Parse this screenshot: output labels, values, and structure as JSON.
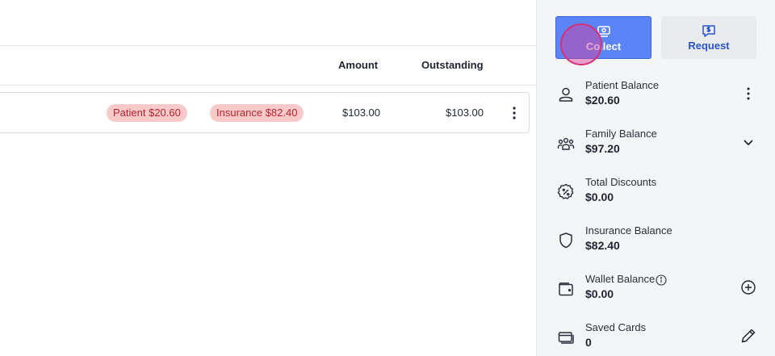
{
  "table": {
    "columns": {
      "amount": "Amount",
      "outstanding": "Outstanding"
    },
    "rows": [
      {
        "patient_pill": "Patient $20.60",
        "insurance_pill": "Insurance $82.40",
        "amount": "$103.00",
        "outstanding": "$103.00"
      }
    ]
  },
  "actions": {
    "collect_label": "Collect",
    "request_label": "Request"
  },
  "balances": {
    "patient": {
      "label": "Patient Balance",
      "value": "$20.60"
    },
    "family": {
      "label": "Family Balance",
      "value": "$97.20"
    },
    "discounts": {
      "label": "Total Discounts",
      "value": "$0.00"
    },
    "insurance": {
      "label": "Insurance Balance",
      "value": "$82.40"
    },
    "wallet": {
      "label": "Wallet Balance",
      "value": "$0.00"
    },
    "cards": {
      "label": "Saved Cards",
      "value": "0"
    }
  },
  "colors": {
    "accent": "#5b85f6",
    "request_text": "#2a55c8",
    "pill_bg": "#f8c9c9",
    "pill_text": "#b3262e"
  },
  "icons": [
    "money-icon",
    "request-money-icon",
    "user-icon",
    "family-icon",
    "discount-icon",
    "shield-icon",
    "wallet-icon",
    "info-icon",
    "add-icon",
    "card-icon",
    "pencil-icon",
    "kebab-icon",
    "chevron-down-icon"
  ]
}
